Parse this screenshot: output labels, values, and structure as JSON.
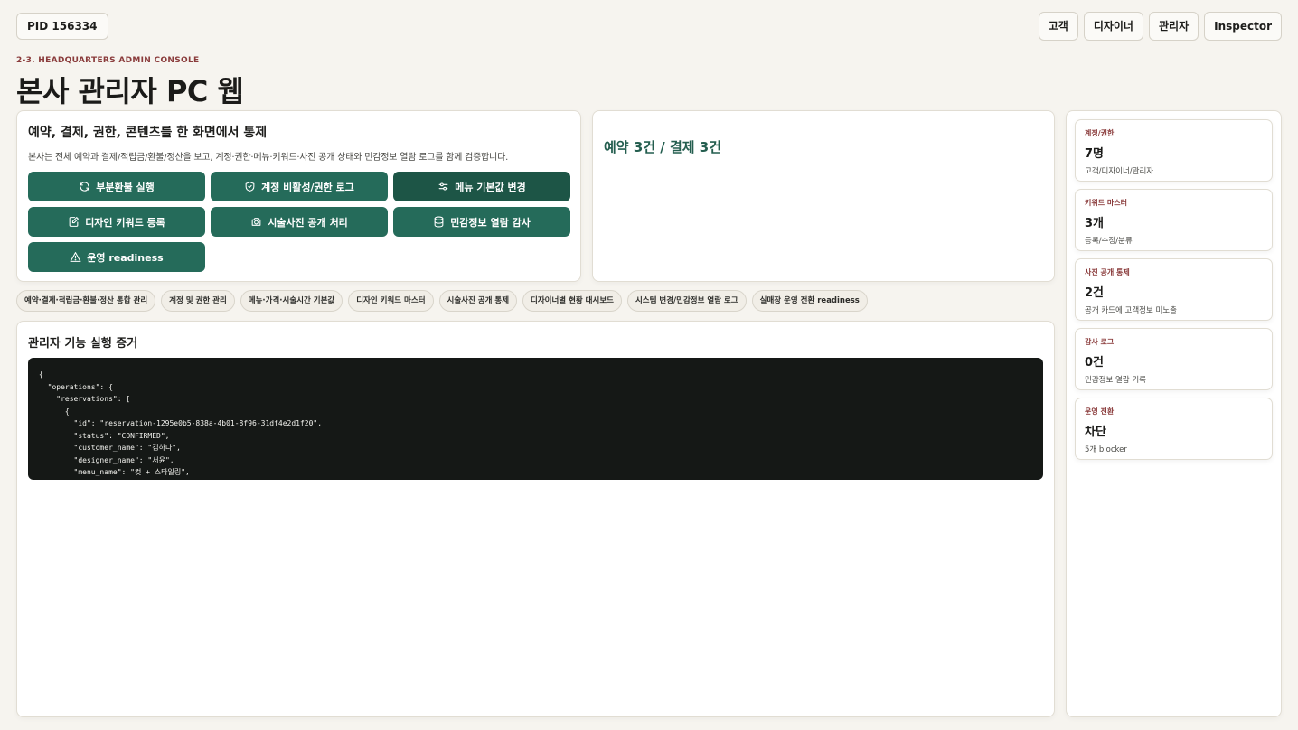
{
  "header": {
    "pid": "PID 156334",
    "roles": [
      "고객",
      "디자이너",
      "관리자",
      "Inspector"
    ],
    "eyebrow": "2-3. HEADQUARTERS ADMIN CONSOLE",
    "title": "본사 관리자 PC 웹"
  },
  "control": {
    "title": "예약, 결제, 권한, 콘텐츠를 한 화면에서 통제",
    "description": "본사는 전체 예약과 결제/적립금/환불/정산을 보고, 계정·권한·메뉴·키워드·사진 공개 상태와 민감정보 열람 로그를 함께 검증합니다.",
    "actions": [
      {
        "label": "부분환불 실행",
        "icon": "refresh-icon"
      },
      {
        "label": "계정 비활성/권한 로그",
        "icon": "shield-icon"
      },
      {
        "label": "메뉴 기본값 변경",
        "icon": "sliders-icon"
      },
      {
        "label": "디자인 키워드 등록",
        "icon": "edit-icon"
      },
      {
        "label": "시술사진 공개 처리",
        "icon": "camera-icon"
      },
      {
        "label": "민감정보 열람 감사",
        "icon": "database-icon"
      },
      {
        "label": "운영 readiness",
        "icon": "warning-icon"
      }
    ]
  },
  "summary": {
    "text": "예약 3건 / 결제 3건"
  },
  "chips": [
    "예약·결제·적립금·환불·정산 통합 관리",
    "계정 및 권한 관리",
    "메뉴·가격·시술시간 기본값",
    "디자인 키워드 마스터",
    "시술사진 공개 통제",
    "디자이너별 현황 대시보드",
    "시스템 변경/민감정보 열람 로그",
    "실매장 운영 전환 readiness"
  ],
  "evidence": {
    "title": "관리자 기능 실행 증거",
    "code_lines": [
      "{",
      "  \"operations\": {",
      "    \"reservations\": [",
      "      {",
      "        \"id\": \"reservation-1295e0b5-838a-4b01-8f96-31df4e2d1f20\",",
      "        \"status\": \"CONFIRMED\",",
      "        \"customer_name\": \"김하나\",",
      "        \"designer_name\": \"서윤\",",
      "        \"menu_name\": \"컷 + 스타일링\","
    ]
  },
  "stats": [
    {
      "label": "계정/권한",
      "value": "7명",
      "desc": "고객/디자이너/관리자"
    },
    {
      "label": "키워드 마스터",
      "value": "3개",
      "desc": "등록/수정/분류"
    },
    {
      "label": "사진 공개 통제",
      "value": "2건",
      "desc": "공개 카드에 고객정보 미노출"
    },
    {
      "label": "감사 로그",
      "value": "0건",
      "desc": "민감정보 열람 기록"
    },
    {
      "label": "운영 전환",
      "value": "차단",
      "desc": "5개 blocker"
    }
  ],
  "colors": {
    "accent": "#256b5a",
    "accent_dark": "#1d5546",
    "eyebrow": "#8a3b3b",
    "background": "#f6f4ef",
    "code_bg": "#151816"
  }
}
